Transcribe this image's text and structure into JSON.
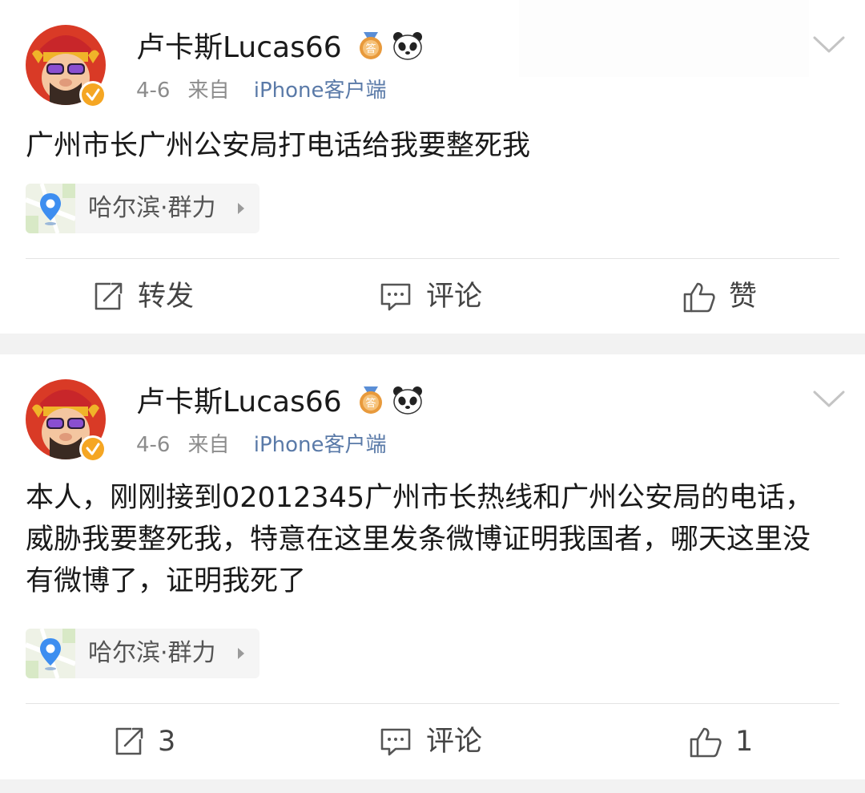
{
  "posts": [
    {
      "username": "卢卡斯Lucas66",
      "date": "4-6",
      "source_prefix": "来自",
      "source": "iPhone客户端",
      "text": "广州市长广州公安局打电话给我要整死我",
      "location": "哈尔滨·群力",
      "actions": {
        "repost": "转发",
        "comment": "评论",
        "like": "赞"
      }
    },
    {
      "username": "卢卡斯Lucas66",
      "date": "4-6",
      "source_prefix": "来自",
      "source": "iPhone客户端",
      "text": "本人，刚刚接到02012345广州市长热线和广州公安局的电话，威胁我要整死我，特意在这里发条微博证明我国者，哪天这里没有微博了，证明我死了",
      "location": "哈尔滨·群力",
      "actions": {
        "repost": "3",
        "comment": "评论",
        "like": "1"
      }
    }
  ],
  "icons": {
    "avatar": "cartoon-avatar-icon",
    "verified": "verified-badge-icon",
    "medal": "medal-badge-icon",
    "panda": "panda-badge-icon",
    "more": "chevron-down-icon",
    "location": "map-pin-icon",
    "repost": "repost-icon",
    "comment": "comment-icon",
    "like": "thumbs-up-icon"
  },
  "colors": {
    "source_link": "#5a7aa8",
    "verified_badge": "#f5a623",
    "location_pin": "#3d8ef0",
    "page_background": "#f2f2f2"
  }
}
